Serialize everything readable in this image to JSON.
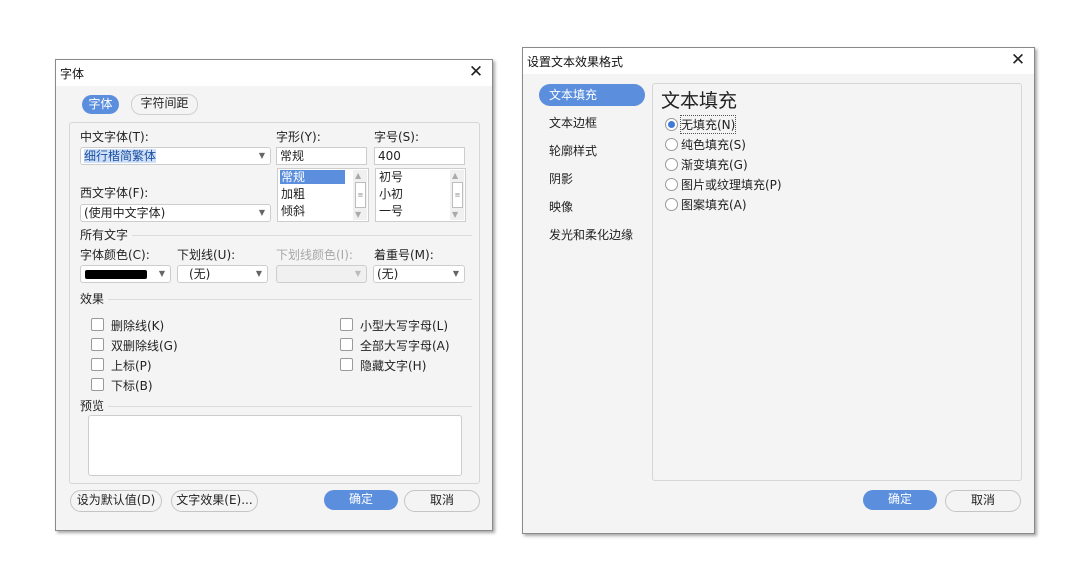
{
  "font_dialog": {
    "title": "字体",
    "tabs": [
      {
        "label": "字体",
        "active": true
      },
      {
        "label": "字符间距",
        "active": false
      }
    ],
    "cn_font": {
      "label": "中文字体(T):",
      "value": "细行楷简繁体"
    },
    "style": {
      "label": "字形(Y):",
      "value": "常规",
      "options": [
        "常规",
        "加粗",
        "倾斜"
      ],
      "selected": "常规"
    },
    "size": {
      "label": "字号(S):",
      "value": "400",
      "options": [
        "初号",
        "小初",
        "一号"
      ]
    },
    "western_font": {
      "label": "西文字体(F):",
      "value": "(使用中文字体)"
    },
    "all_text_section": "所有文字",
    "font_color": {
      "label": "字体颜色(C):",
      "swatch": "#000000"
    },
    "underline": {
      "label": "下划线(U):",
      "value": "(无)"
    },
    "underline_color": {
      "label": "下划线颜色(I):",
      "value": ""
    },
    "emphasis": {
      "label": "着重号(M):",
      "value": "(无)"
    },
    "effects_section": "效果",
    "effects_left": [
      "删除线(K)",
      "双删除线(G)",
      "上标(P)",
      "下标(B)"
    ],
    "effects_right": [
      "小型大写字母(L)",
      "全部大写字母(A)",
      "隐藏文字(H)"
    ],
    "preview_section": "预览",
    "buttons": {
      "set_default": "设为默认值(D)",
      "text_effects": "文字效果(E)...",
      "ok": "确定",
      "cancel": "取消"
    }
  },
  "effects_dialog": {
    "title": "设置文本效果格式",
    "nav": [
      "文本填充",
      "文本边框",
      "轮廓样式",
      "阴影",
      "映像",
      "发光和柔化边缘"
    ],
    "active_nav": "文本填充",
    "section_title": "文本填充",
    "fill_options": [
      "无填充(N)",
      "纯色填充(S)",
      "渐变填充(G)",
      "图片或纹理填充(P)",
      "图案填充(A)"
    ],
    "selected_fill": "无填充(N)",
    "buttons": {
      "ok": "确定",
      "cancel": "取消"
    }
  },
  "colors": {
    "accent": "#5b8fdd",
    "dialog_bg": "#f4f4f4"
  }
}
